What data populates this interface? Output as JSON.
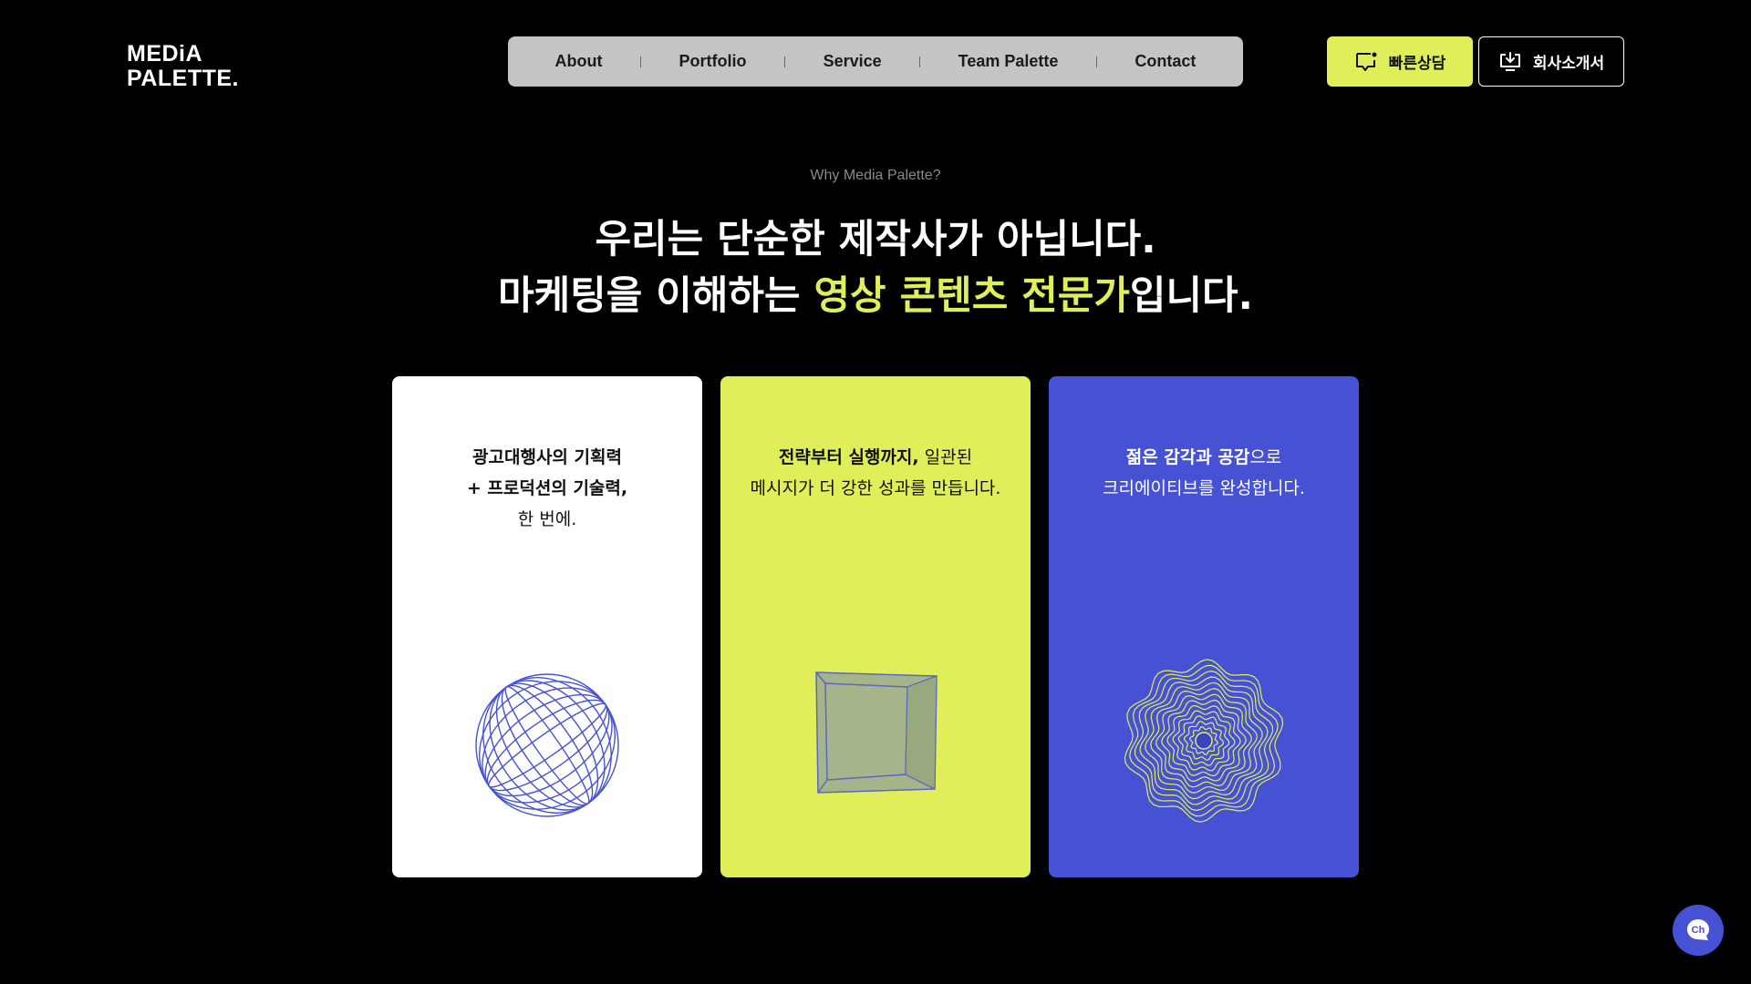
{
  "header": {
    "logo_line1": "MEDiA",
    "logo_line2": "PALETTE.",
    "nav": [
      {
        "label": "About"
      },
      {
        "label": "Portfolio"
      },
      {
        "label": "Service"
      },
      {
        "label": "Team Palette"
      },
      {
        "label": "Contact"
      }
    ],
    "consult_button": "빠른상담",
    "intro_button": "회사소개서"
  },
  "section": {
    "eyebrow": "Why Media Palette?",
    "headline_line1": "우리는 단순한 제작사가 아닙니다.",
    "headline_line2_pre": "마케팅을 이해하는 ",
    "headline_line2_highlight": "영상 콘텐츠 전문가",
    "headline_line2_post": "입니다."
  },
  "cards": [
    {
      "bold_1": "광고대행사의 기획력",
      "bold_2": "+ 프로덕션의 기술력,",
      "text_3": "한 번에."
    },
    {
      "bold_1": "전략부터 실행까지,",
      "text_1": " 일관된",
      "text_2": "메시지가 더 강한 성과를 만듭니다."
    },
    {
      "bold_1": "젊은 감각과 공감",
      "text_1": "으로",
      "text_2": "크리에이티브를 완성합니다."
    }
  ],
  "icons": {
    "card1": "wireframe-sphere-icon",
    "card2": "cube-frame-icon",
    "card3": "wave-rings-icon",
    "chat": "channel-chat-icon"
  },
  "chat_label": "Ch",
  "colors": {
    "accent_lime": "#e0ef59",
    "accent_blue": "#4652d3",
    "nav_bg": "#c4c4c4",
    "bg": "#000000"
  }
}
